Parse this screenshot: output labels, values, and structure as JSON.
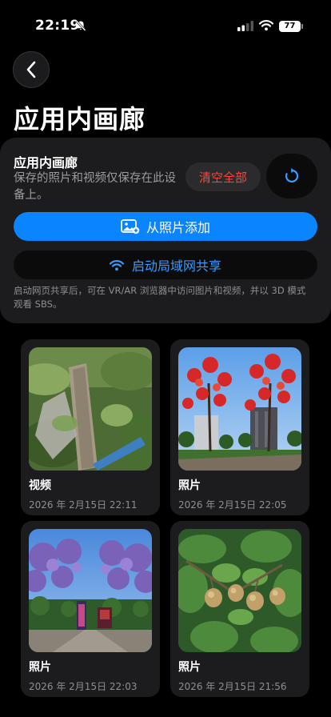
{
  "status": {
    "time": "22:19",
    "battery": "77",
    "icons": [
      "bell-muted-icon",
      "signal-icon",
      "wifi-icon",
      "battery-icon"
    ]
  },
  "page": {
    "title": "应用内画廊",
    "back_icon": "chevron-left-icon"
  },
  "panel": {
    "title": "应用内画廊",
    "description": "保存的照片和视频仅保存在此设备上。",
    "clear_label": "清空全部",
    "refresh_icon": "refresh-icon",
    "add_label": "从照片添加",
    "add_icon": "add-photo-icon",
    "share_label": "启动局域网共享",
    "share_icon": "wifi-icon",
    "note": "启动网页共享后，可在 VR/AR 浏览器中访问图片和视频，并以 3D 模式观看 SBS。"
  },
  "gallery": [
    {
      "type": "视频",
      "date": "2026 年 2月15日 22:11"
    },
    {
      "type": "照片",
      "date": "2026 年 2月15日 22:05"
    },
    {
      "type": "照片",
      "date": "2026 年 2月15日 22:03"
    },
    {
      "type": "照片",
      "date": "2026 年 2月15日 21:56"
    }
  ],
  "colors": {
    "accent": "#0a84ff",
    "danger": "#ff453a",
    "panel": "#1c1c1e",
    "background": "#000000"
  }
}
